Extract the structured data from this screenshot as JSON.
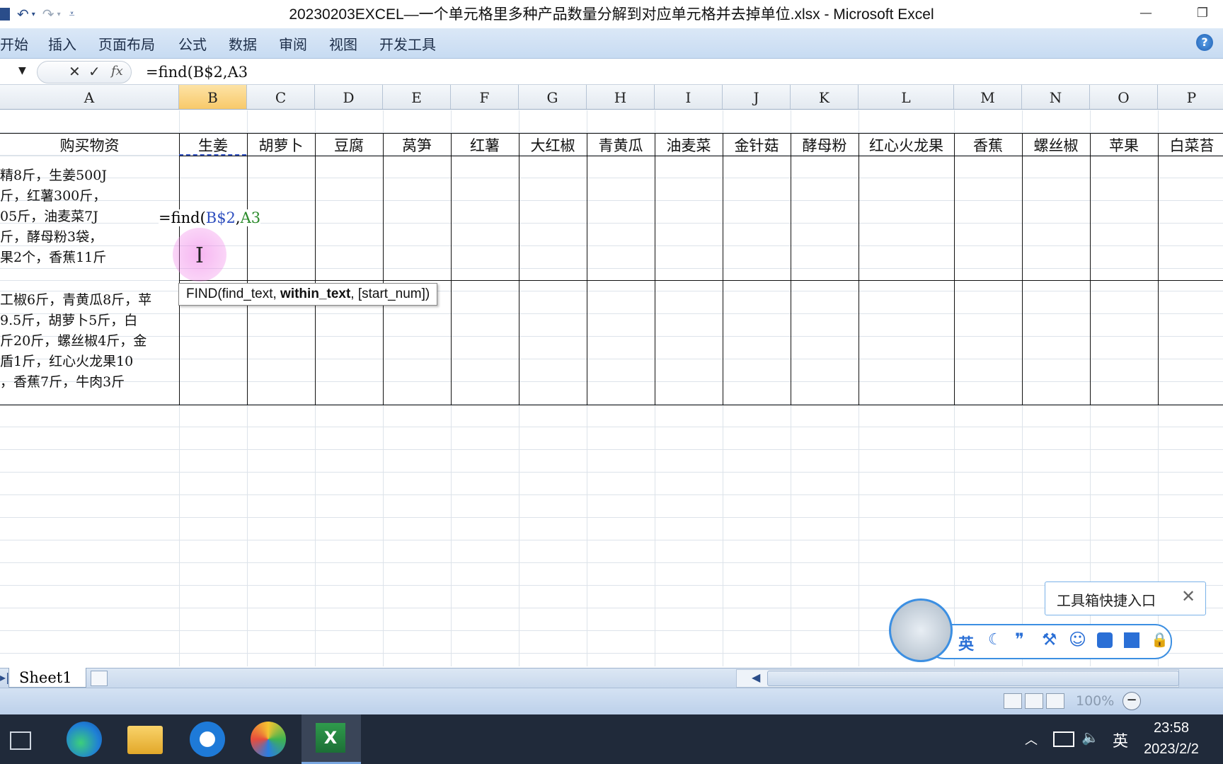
{
  "window": {
    "title": "20230203EXCEL—一个单元格里多种产品数量分解到对应单元格并去掉单位.xlsx - Microsoft Excel",
    "minimize_label": "—",
    "restore_label": "❐"
  },
  "ribbon": {
    "tabs": [
      "开始",
      "插入",
      "页面布局",
      "公式",
      "数据",
      "审阅",
      "视图",
      "开发工具"
    ],
    "help_label": "?"
  },
  "formula_bar": {
    "formula": "=find(B$2,A3",
    "cancel_icon": "✕",
    "enter_icon": "✓",
    "fx_label": "fx"
  },
  "columns": [
    "A",
    "B",
    "C",
    "D",
    "E",
    "F",
    "G",
    "H",
    "I",
    "J",
    "K",
    "L",
    "M",
    "N",
    "O",
    "P"
  ],
  "selected_column": "B",
  "header_row": [
    "购买物资",
    "生姜",
    "胡萝卜",
    "豆腐",
    "莴笋",
    "红薯",
    "大红椒",
    "青黄瓜",
    "油麦菜",
    "金针菇",
    "酵母粉",
    "红心火龙果",
    "香蕉",
    "螺丝椒",
    "苹果",
    "白菜苔"
  ],
  "row3_lines": [
    "精8斤，生姜500J",
    "斤，红薯300斤，",
    "05斤，油麦菜7J",
    "斤，酵母粉3袋，",
    "果2个，香蕉11斤"
  ],
  "row4_lines": [
    "工椒6斤，青黄瓜8斤，苹",
    "9.5斤，胡萝卜5斤，白",
    "斤20斤，螺丝椒4斤，金",
    "盾1斤，红心火龙果10",
    "，香蕉7斤，牛肉3斤"
  ],
  "editing_cell": {
    "prefix": "=find(",
    "ref1": "B$2",
    "sep": ",",
    "ref2": "A3",
    "ref1_color": "#2f4fbf",
    "ref2_color": "#2a8a2a"
  },
  "tooltip": {
    "fn": "FIND(find_text, ",
    "bold_arg": "within_text",
    "rest": ", [start_num])"
  },
  "sheet_tab": "Sheet1",
  "status": {
    "zoom": "100%"
  },
  "ime": {
    "tip": "工具箱快捷入口",
    "lang": "英"
  },
  "taskbar": {
    "tray_lang": "英",
    "time": "23:58",
    "date": "2023/2/2"
  }
}
